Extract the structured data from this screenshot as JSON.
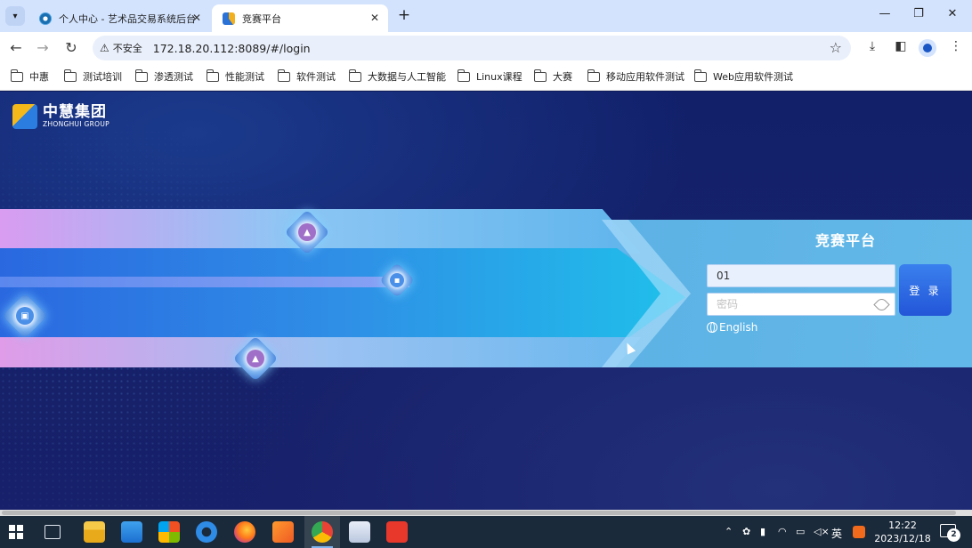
{
  "browser": {
    "tabs": [
      {
        "title": "个人中心 - 艺术品交易系统后台"
      },
      {
        "title": "竞赛平台"
      }
    ],
    "security_label": "不安全",
    "url": "172.18.20.112:8089/#/login",
    "bookmarks": [
      "中惠",
      "测试培训",
      "渗透测试",
      "性能测试",
      "软件测试",
      "大数据与人工智能",
      "Linux课程",
      "大赛",
      "移动应用软件测试",
      "Web应用软件测试"
    ]
  },
  "page": {
    "logo_cn": "中慧集团",
    "logo_en": "ZHONGHUI GROUP",
    "login_title": "竞赛平台",
    "username_value": "01",
    "password_placeholder": "密码",
    "login_button": "登 录",
    "language_link": "English"
  },
  "taskbar": {
    "tray_input_method": "英",
    "time": "12:22",
    "date": "2023/12/18",
    "notification_count": "2"
  },
  "colors": {
    "accent": "#2356d8",
    "page_bg": "#12206a",
    "tab_strip": "#d3e3fd"
  }
}
